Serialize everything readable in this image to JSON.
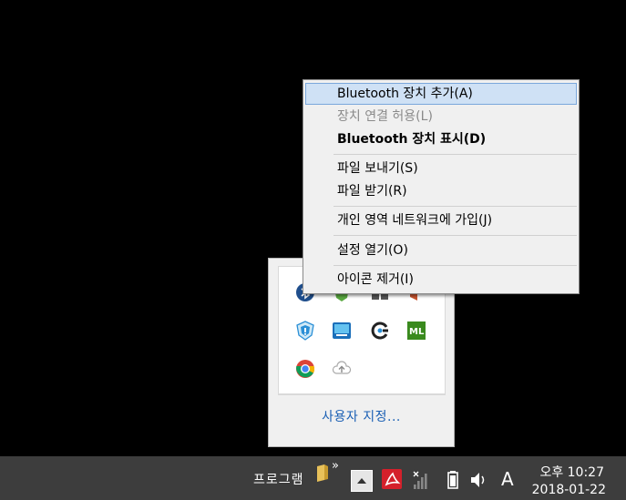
{
  "context_menu": {
    "items": [
      {
        "label": "Bluetooth 장치 추가(A)",
        "state": "highlighted"
      },
      {
        "label": "장치 연결 허용(L)",
        "state": "disabled"
      },
      {
        "label": "Bluetooth 장치 표시(D)",
        "state": "default-bold"
      },
      {
        "label": "파일 보내기(S)",
        "state": "normal"
      },
      {
        "label": "파일 받기(R)",
        "state": "normal"
      },
      {
        "label": "개인 영역 네트워크에 가입(J)",
        "state": "normal"
      },
      {
        "label": "설정 열기(O)",
        "state": "normal"
      },
      {
        "label": "아이콘 제거(I)",
        "state": "normal"
      }
    ]
  },
  "tray_flyout": {
    "icons": [
      "bluetooth-icon",
      "shield-check-icon",
      "network-adapter-icon",
      "media-icon",
      "security-shield-icon",
      "intel-graphics-icon",
      "refresh-app-icon",
      "ml-app-icon",
      "chrome-icon",
      "cloud-upload-icon"
    ],
    "customize_label": "사용자 지정..."
  },
  "taskbar": {
    "toolbar_label": "프로그램",
    "overflow_chevron": "»",
    "ime_indicator": "A",
    "clock": {
      "time": "오후 10:27",
      "date": "2018-01-22"
    }
  },
  "colors": {
    "taskbar_bg": "#3d3d3d",
    "menu_bg": "#f0f0f0",
    "menu_highlight": "#cfe1f5",
    "link": "#1a5fb4"
  }
}
